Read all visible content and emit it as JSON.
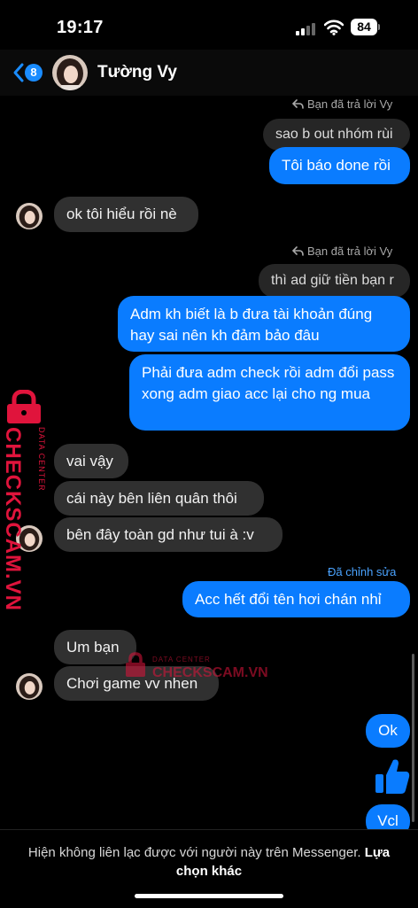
{
  "status_bar": {
    "time": "19:17",
    "battery": "84"
  },
  "header": {
    "back_count": "8",
    "contact_name": "Tường Vy"
  },
  "messages": {
    "reply1": "Bạn đã trả lời Vy",
    "q1": "sao b out nhóm rùi",
    "m1": "Tôi báo done rồi",
    "m2": "ok tôi hiểu rồi nè",
    "reply2": "Bạn đã trả lời Vy",
    "q2": "thì ad giữ tiền bạn r",
    "m3": "Adm kh biết là b đưa tài khoản đúng hay sai nên kh đảm bảo đâu",
    "m4": "Phải đưa adm check rồi adm đổi pass xong adm giao acc lại cho ng mua",
    "m5": "vai vậy",
    "m6": "cái này bên liên quân thôi",
    "m7": "bên đây toàn gd như tui à :v",
    "edited": "Đã chỉnh sửa",
    "m8": "Acc hết đổi tên hơi chán nhỉ",
    "m9": "Um bạn",
    "m10": "Chơi game vv nhen",
    "m11": "Ok",
    "m13": "Vcl"
  },
  "watermark": {
    "line1": "DATA CENTER",
    "line2": "CHECKSCAM.VN"
  },
  "footer": {
    "notice": "Hiện không liên lạc được với người này trên Messenger.",
    "link": "Lựa chọn khác"
  },
  "colors": {
    "outgoing": "#0a7cff",
    "incoming": "#303030",
    "watermark": "#e0143c",
    "edited": "#4aa3ff"
  },
  "icons": [
    "cellular-signal-icon",
    "wifi-icon",
    "battery-icon",
    "back-chevron-icon",
    "reply-arrow-icon",
    "thumbs-up-icon",
    "padlock-icon"
  ]
}
